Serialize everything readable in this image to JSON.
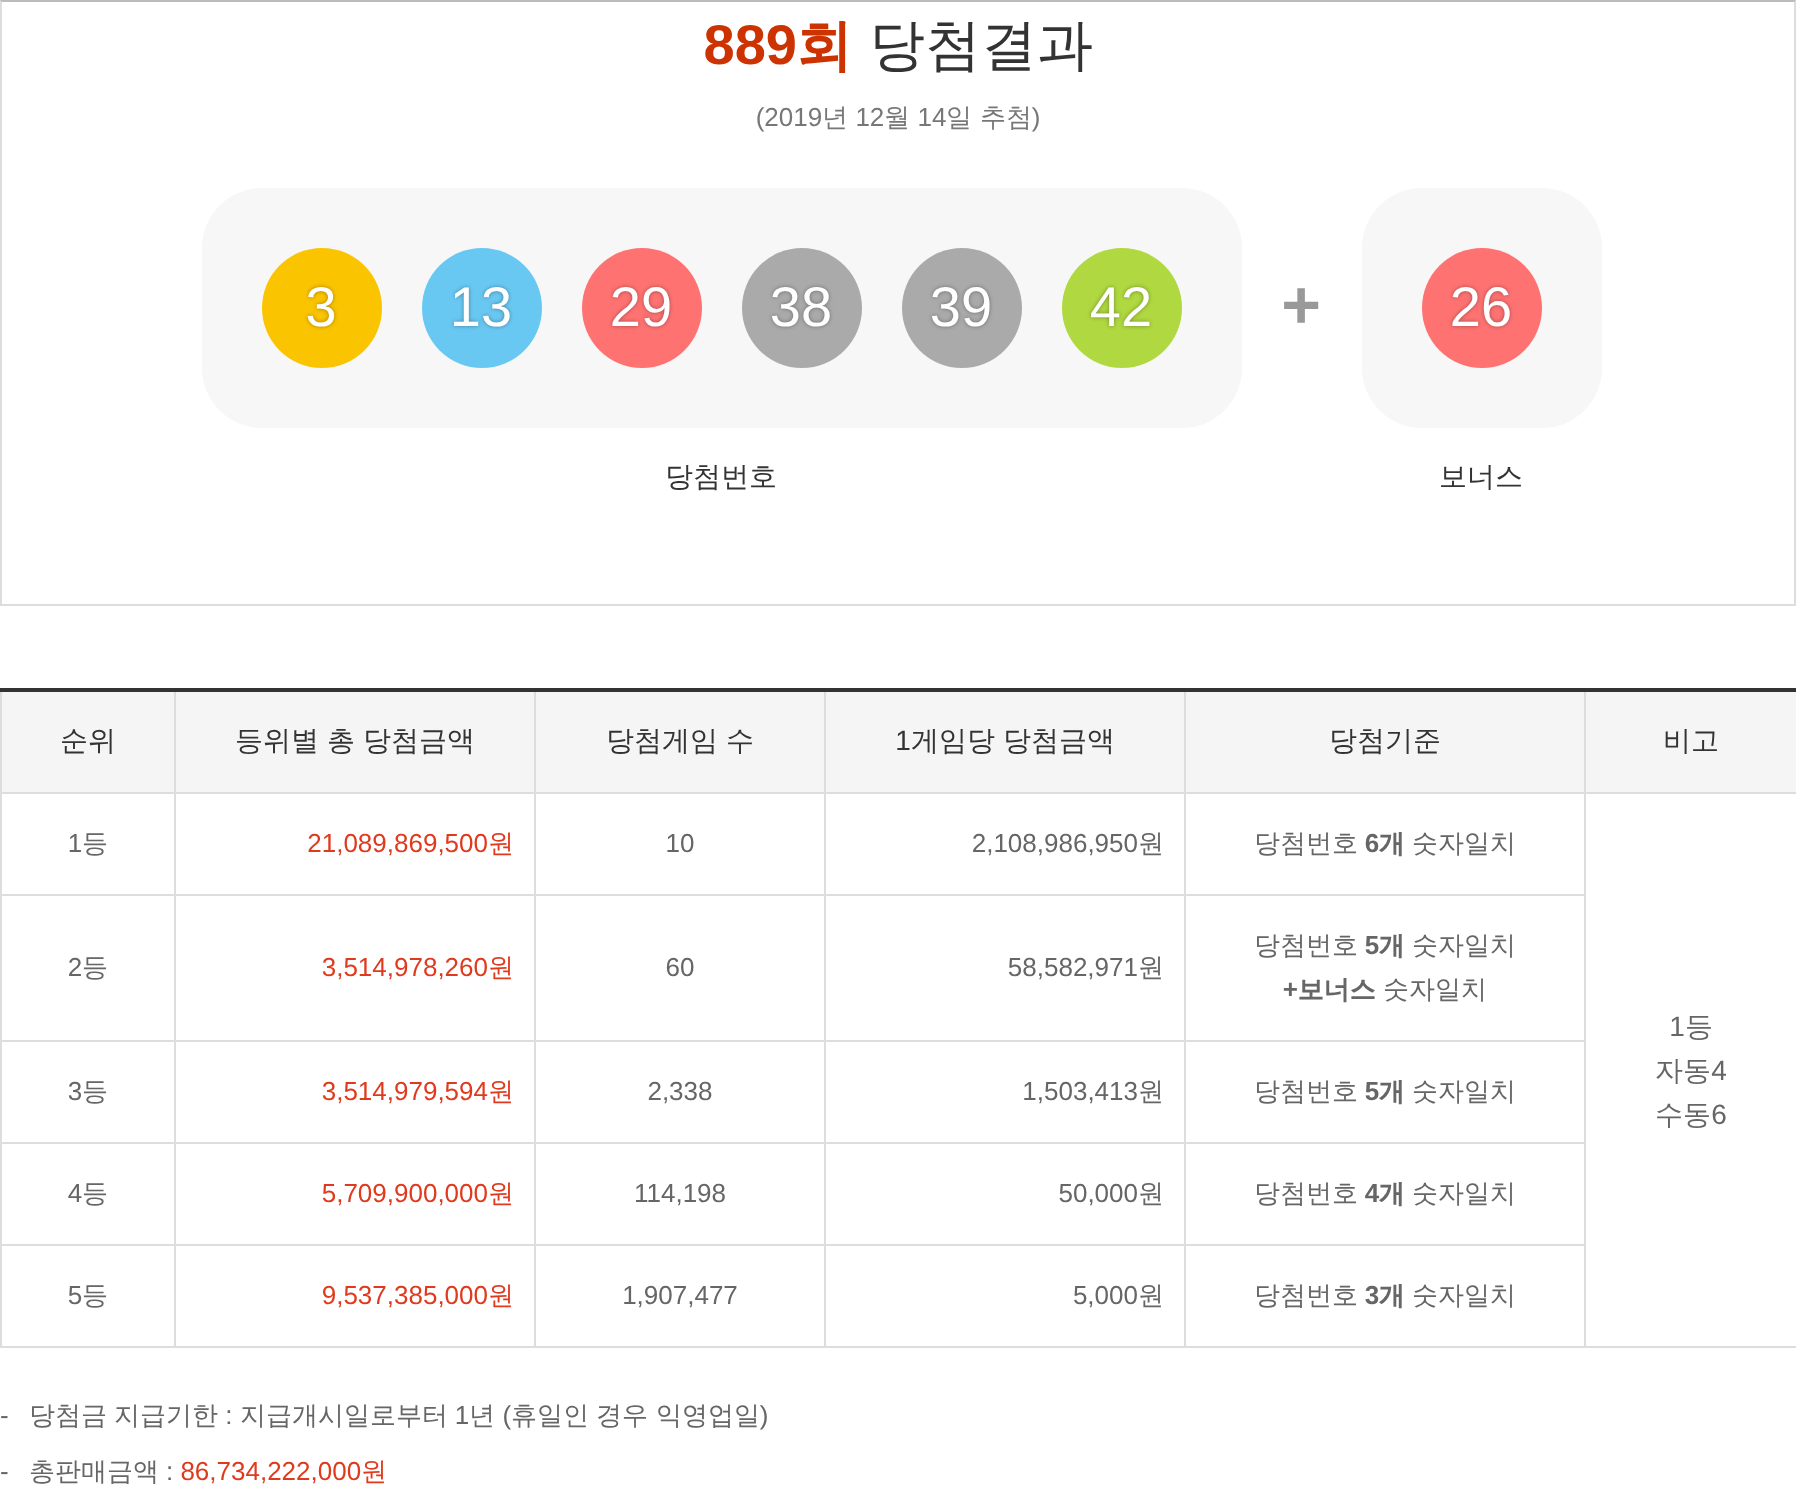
{
  "draw": {
    "round": "889회",
    "title": "당첨결과",
    "date": "(2019년 12월 14일 추첨)",
    "numbers": [
      {
        "value": "3",
        "color": "#fbc400"
      },
      {
        "value": "13",
        "color": "#69c8f2"
      },
      {
        "value": "29",
        "color": "#ff7272"
      },
      {
        "value": "38",
        "color": "#aaaaaa"
      },
      {
        "value": "39",
        "color": "#aaaaaa"
      },
      {
        "value": "42",
        "color": "#b0d840"
      }
    ],
    "plus": "+",
    "bonus": {
      "value": "26",
      "color": "#ff7272"
    },
    "numbers_label": "당첨번호",
    "bonus_label": "보너스"
  },
  "table": {
    "columns": [
      "순위",
      "등위별 총 당첨금액",
      "당첨게임 수",
      "1게임당 당첨금액",
      "당첨기준",
      "비고"
    ],
    "rows": [
      {
        "rank": "1등",
        "total": "21,089,869,500원",
        "winners": "10",
        "per_game": "2,108,986,950원",
        "criteria": [
          "당첨번호 **6개** 숫자일치"
        ]
      },
      {
        "rank": "2등",
        "total": "3,514,978,260원",
        "winners": "60",
        "per_game": "58,582,971원",
        "criteria": [
          "당첨번호 **5개** 숫자일치",
          "**+보너스** 숫자일치"
        ]
      },
      {
        "rank": "3등",
        "total": "3,514,979,594원",
        "winners": "2,338",
        "per_game": "1,503,413원",
        "criteria": [
          "당첨번호 **5개** 숫자일치"
        ]
      },
      {
        "rank": "4등",
        "total": "5,709,900,000원",
        "winners": "114,198",
        "per_game": "50,000원",
        "criteria": [
          "당첨번호 **4개** 숫자일치"
        ]
      },
      {
        "rank": "5등",
        "total": "9,537,385,000원",
        "winners": "1,907,477",
        "per_game": "5,000원",
        "criteria": [
          "당첨번호 **3개** 숫자일치"
        ]
      }
    ],
    "remarks": [
      "1등",
      "자동4",
      "수동6"
    ]
  },
  "notes": [
    {
      "marker": "-",
      "label": "당첨금 지급기한 :",
      "value": "지급개시일로부터 1년 (휴일인 경우 익영업일)",
      "kind": "plain"
    },
    {
      "marker": "-",
      "label": "총판매금액 :",
      "value": "86,734,222,000원",
      "kind": "amount"
    }
  ]
}
